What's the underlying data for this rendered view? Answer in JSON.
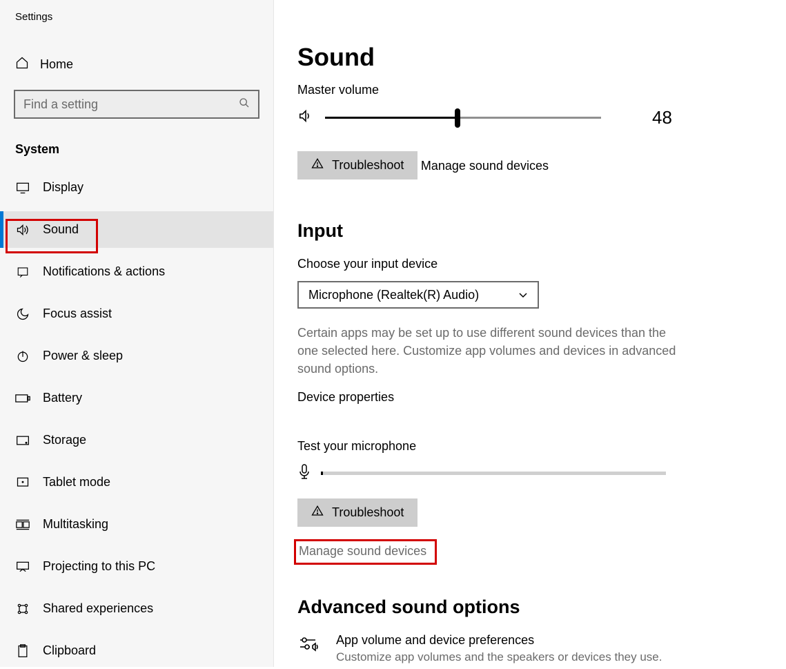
{
  "window": {
    "title": "Settings"
  },
  "sidebar": {
    "home_label": "Home",
    "search_placeholder": "Find a setting",
    "category": "System",
    "items": [
      {
        "label": "Display",
        "icon": "display"
      },
      {
        "label": "Sound",
        "icon": "sound",
        "active": true
      },
      {
        "label": "Notifications & actions",
        "icon": "notifications"
      },
      {
        "label": "Focus assist",
        "icon": "focus"
      },
      {
        "label": "Power & sleep",
        "icon": "power"
      },
      {
        "label": "Battery",
        "icon": "battery"
      },
      {
        "label": "Storage",
        "icon": "storage"
      },
      {
        "label": "Tablet mode",
        "icon": "tablet"
      },
      {
        "label": "Multitasking",
        "icon": "multitasking"
      },
      {
        "label": "Projecting to this PC",
        "icon": "projecting"
      },
      {
        "label": "Shared experiences",
        "icon": "shared"
      },
      {
        "label": "Clipboard",
        "icon": "clipboard"
      }
    ]
  },
  "main": {
    "page_title": "Sound",
    "master_volume_label": "Master volume",
    "volume_value": "48",
    "troubleshoot1": "Troubleshoot",
    "manage1": "Manage sound devices",
    "input_header": "Input",
    "choose_label": "Choose your input device",
    "selected_device": "Microphone (Realtek(R) Audio)",
    "explain": "Certain apps may be set up to use different sound devices than the one selected here. Customize app volumes and devices in advanced sound options.",
    "device_props": "Device properties",
    "test_mic": "Test your microphone",
    "troubleshoot2": "Troubleshoot",
    "manage2": "Manage sound devices",
    "adv_header": "Advanced sound options",
    "adv_title": "App volume and device preferences",
    "adv_sub": "Customize app volumes and the speakers or devices they use."
  }
}
